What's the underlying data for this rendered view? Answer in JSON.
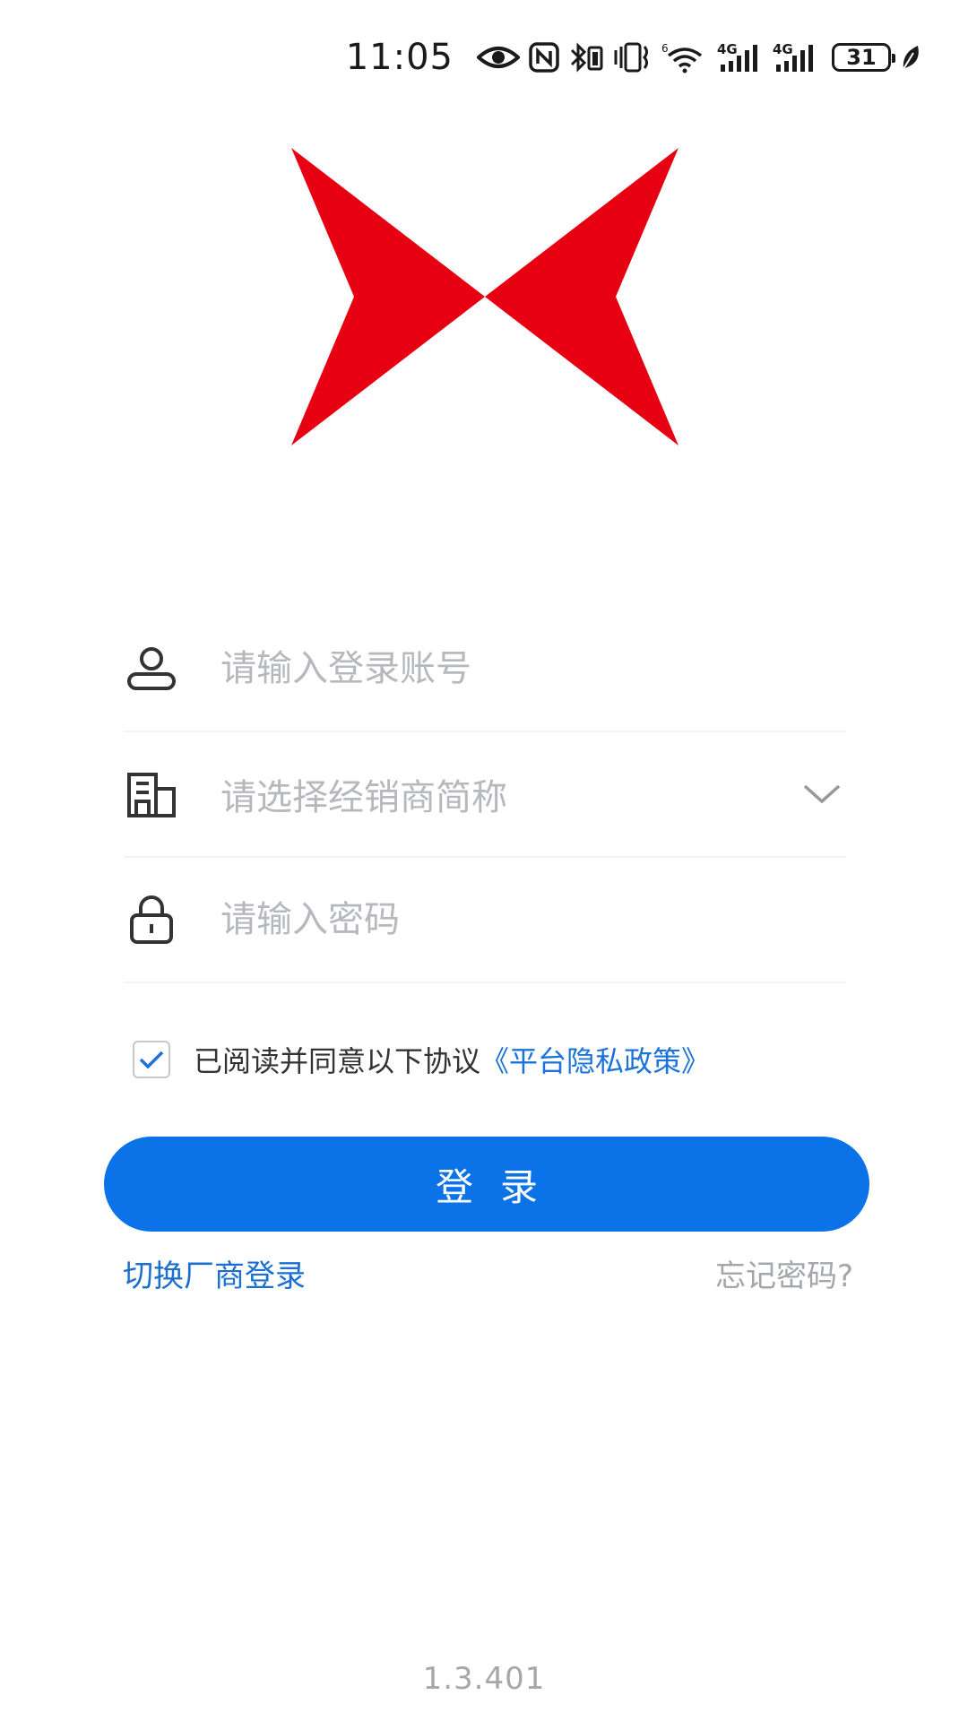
{
  "status_bar": {
    "time": "11:05",
    "battery": "31",
    "icons": [
      "eye-icon",
      "nfc-icon",
      "bluetooth-icon",
      "vibrate-icon",
      "wifi-6-icon",
      "signal-4g-icon",
      "signal-4g-icon",
      "battery-icon",
      "leaf-icon"
    ]
  },
  "logo": {
    "name": "red-bowtie-logo",
    "color": "#e60012"
  },
  "form": {
    "account": {
      "icon": "user-icon",
      "placeholder": "请输入登录账号",
      "value": ""
    },
    "dealer": {
      "icon": "building-icon",
      "placeholder": "请选择经销商简称",
      "chevron_icon": "chevron-down-icon"
    },
    "password": {
      "icon": "lock-icon",
      "placeholder": "请输入密码",
      "value": ""
    }
  },
  "agreement": {
    "checked": true,
    "text": "已阅读并同意以下协议",
    "link": "《平台隐私政策》"
  },
  "login_button": "登录",
  "switch_vendor_link": "切换厂商登录",
  "forgot_password_link": "忘记密码?",
  "version": "1.3.401",
  "colors": {
    "primary": "#0b73e7",
    "link": "#1a73d9",
    "placeholder": "#b6b8bd",
    "logo_red": "#e60012"
  }
}
